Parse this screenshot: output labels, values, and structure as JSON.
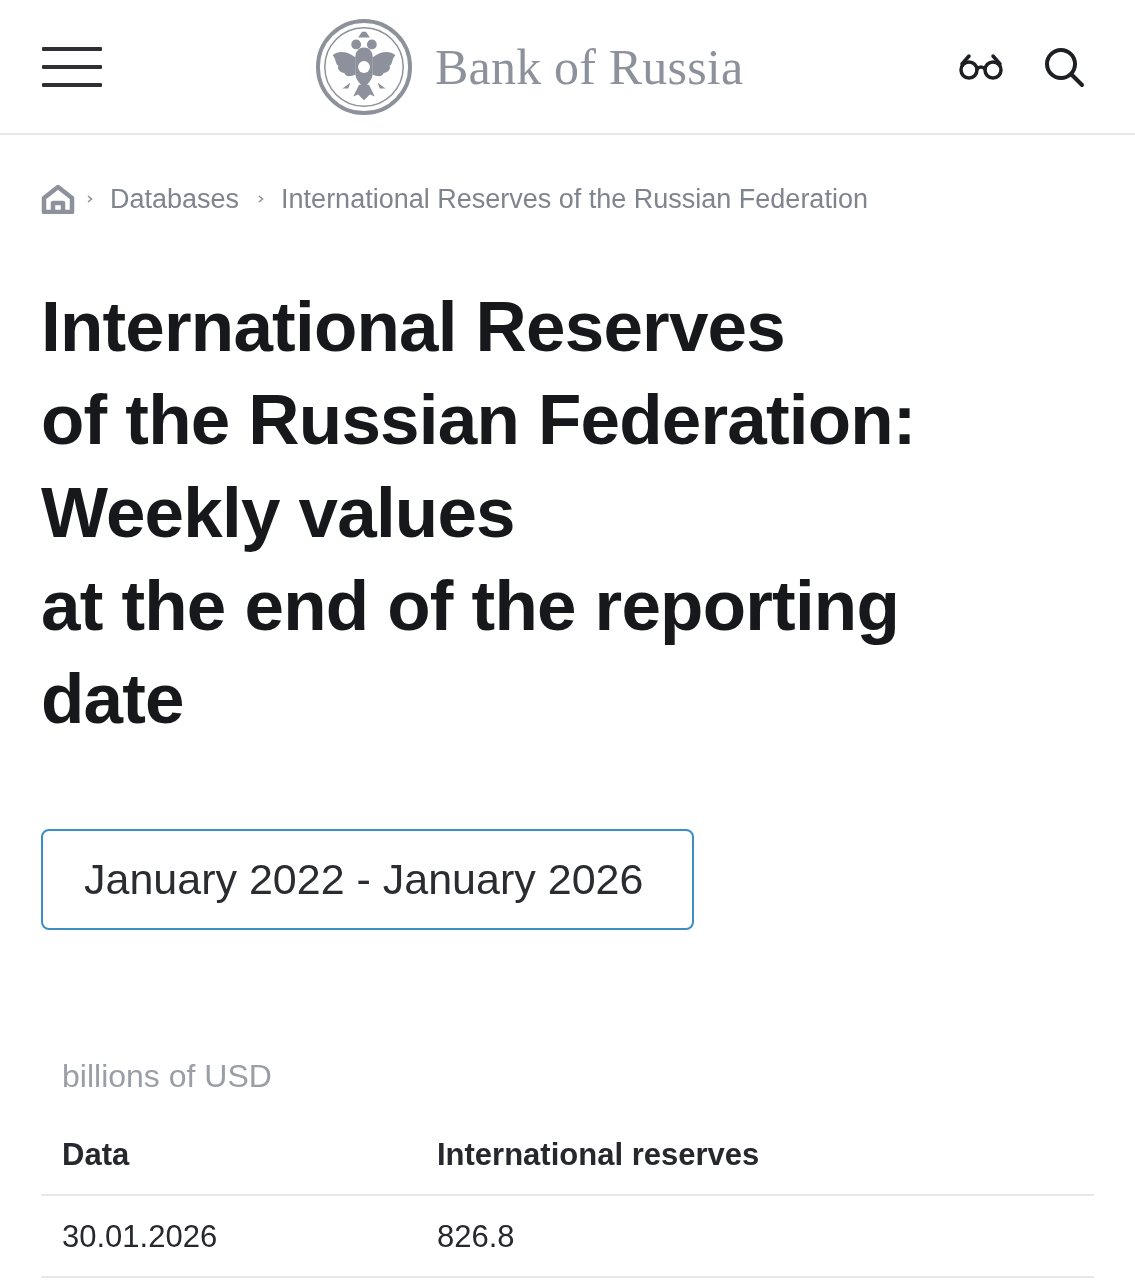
{
  "header": {
    "logo_text": "Bank of Russia"
  },
  "breadcrumbs": [
    {
      "label": "Databases"
    },
    {
      "label": "International Reserves of the Russian Federation"
    }
  ],
  "title": [
    "International Reserves",
    "of the Russian Federation:",
    "Weekly values",
    "at the end of the reporting",
    "date"
  ],
  "period_selector": {
    "value": "January 2022 - January 2026"
  },
  "table": {
    "unit": "billions of USD",
    "columns": [
      "Data",
      "International reserves"
    ],
    "rows": [
      [
        "30.01.2026",
        "826.8"
      ]
    ]
  }
}
